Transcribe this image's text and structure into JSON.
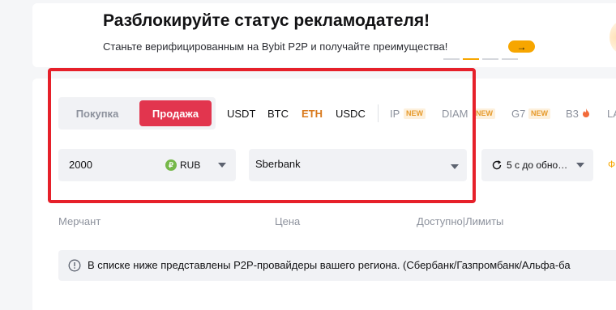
{
  "banner": {
    "title": "Разблокируйте статус рекламодателя!",
    "subtitle": "Станьте верифицированным на Bybit P2P и получайте преимущества!",
    "arrow": "→"
  },
  "tabs": {
    "buy": "Покупка",
    "sell": "Продажа"
  },
  "coins": [
    "USDT",
    "BTC",
    "ETH",
    "USDC",
    "IP",
    "DIAM",
    "G7",
    "B3",
    "LA"
  ],
  "active_coin": "ETH",
  "new_badge": "NEW",
  "filters": {
    "amount": "2000",
    "currency": "RUB",
    "currency_icon": "₽",
    "payment": "Sberbank",
    "refresh": "5 с до обно…",
    "edge_char": "Ф"
  },
  "table_headers": {
    "merchant": "Мерчант",
    "price": "Цена",
    "available": "Доступно|Лимиты"
  },
  "notice": "В списке ниже представлены P2P-провайдеры вашего региона. (Сбербанк/Газпромбанк/Альфа-ба",
  "colors": {
    "accent": "#f7a600",
    "sell": "#e2354e",
    "active_coin": "#d9791c",
    "highlight_frame": "#e6202a"
  }
}
